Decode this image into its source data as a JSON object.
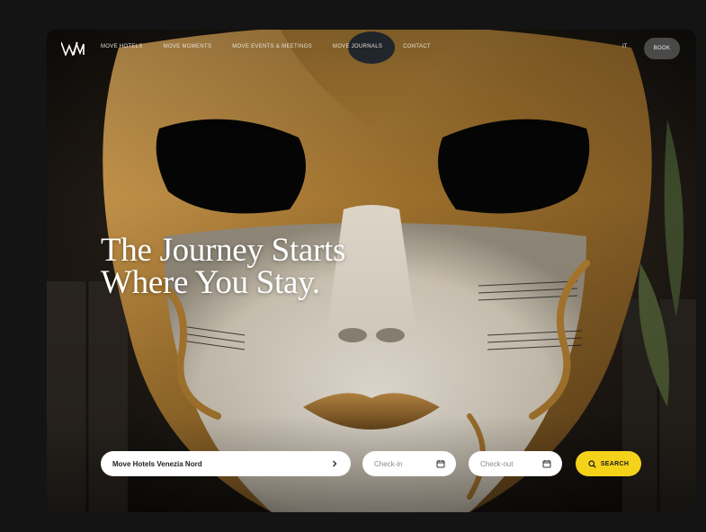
{
  "nav": {
    "links": [
      "MOVE HOTELS",
      "MOVE MOMENTS",
      "MOVE EVENTS & MEETINGS",
      "MOVE JOURNALS",
      "CONTACT"
    ],
    "language": "IT",
    "book_label": "BOOK"
  },
  "hero": {
    "headline_line1": "The Journey Starts",
    "headline_line2": "Where You Stay."
  },
  "booking": {
    "hotel_value": "Move Hotels Venezia Nord",
    "checkin_placeholder": "Check-in",
    "checkout_placeholder": "Check-out",
    "search_label": "SEARCH"
  },
  "colors": {
    "accent": "#f5d21a",
    "mask_gold": "#b8893f",
    "mask_white": "#e8e1d4"
  },
  "icons": [
    "logo-icon",
    "chevron-right-icon",
    "calendar-icon",
    "search-icon"
  ]
}
